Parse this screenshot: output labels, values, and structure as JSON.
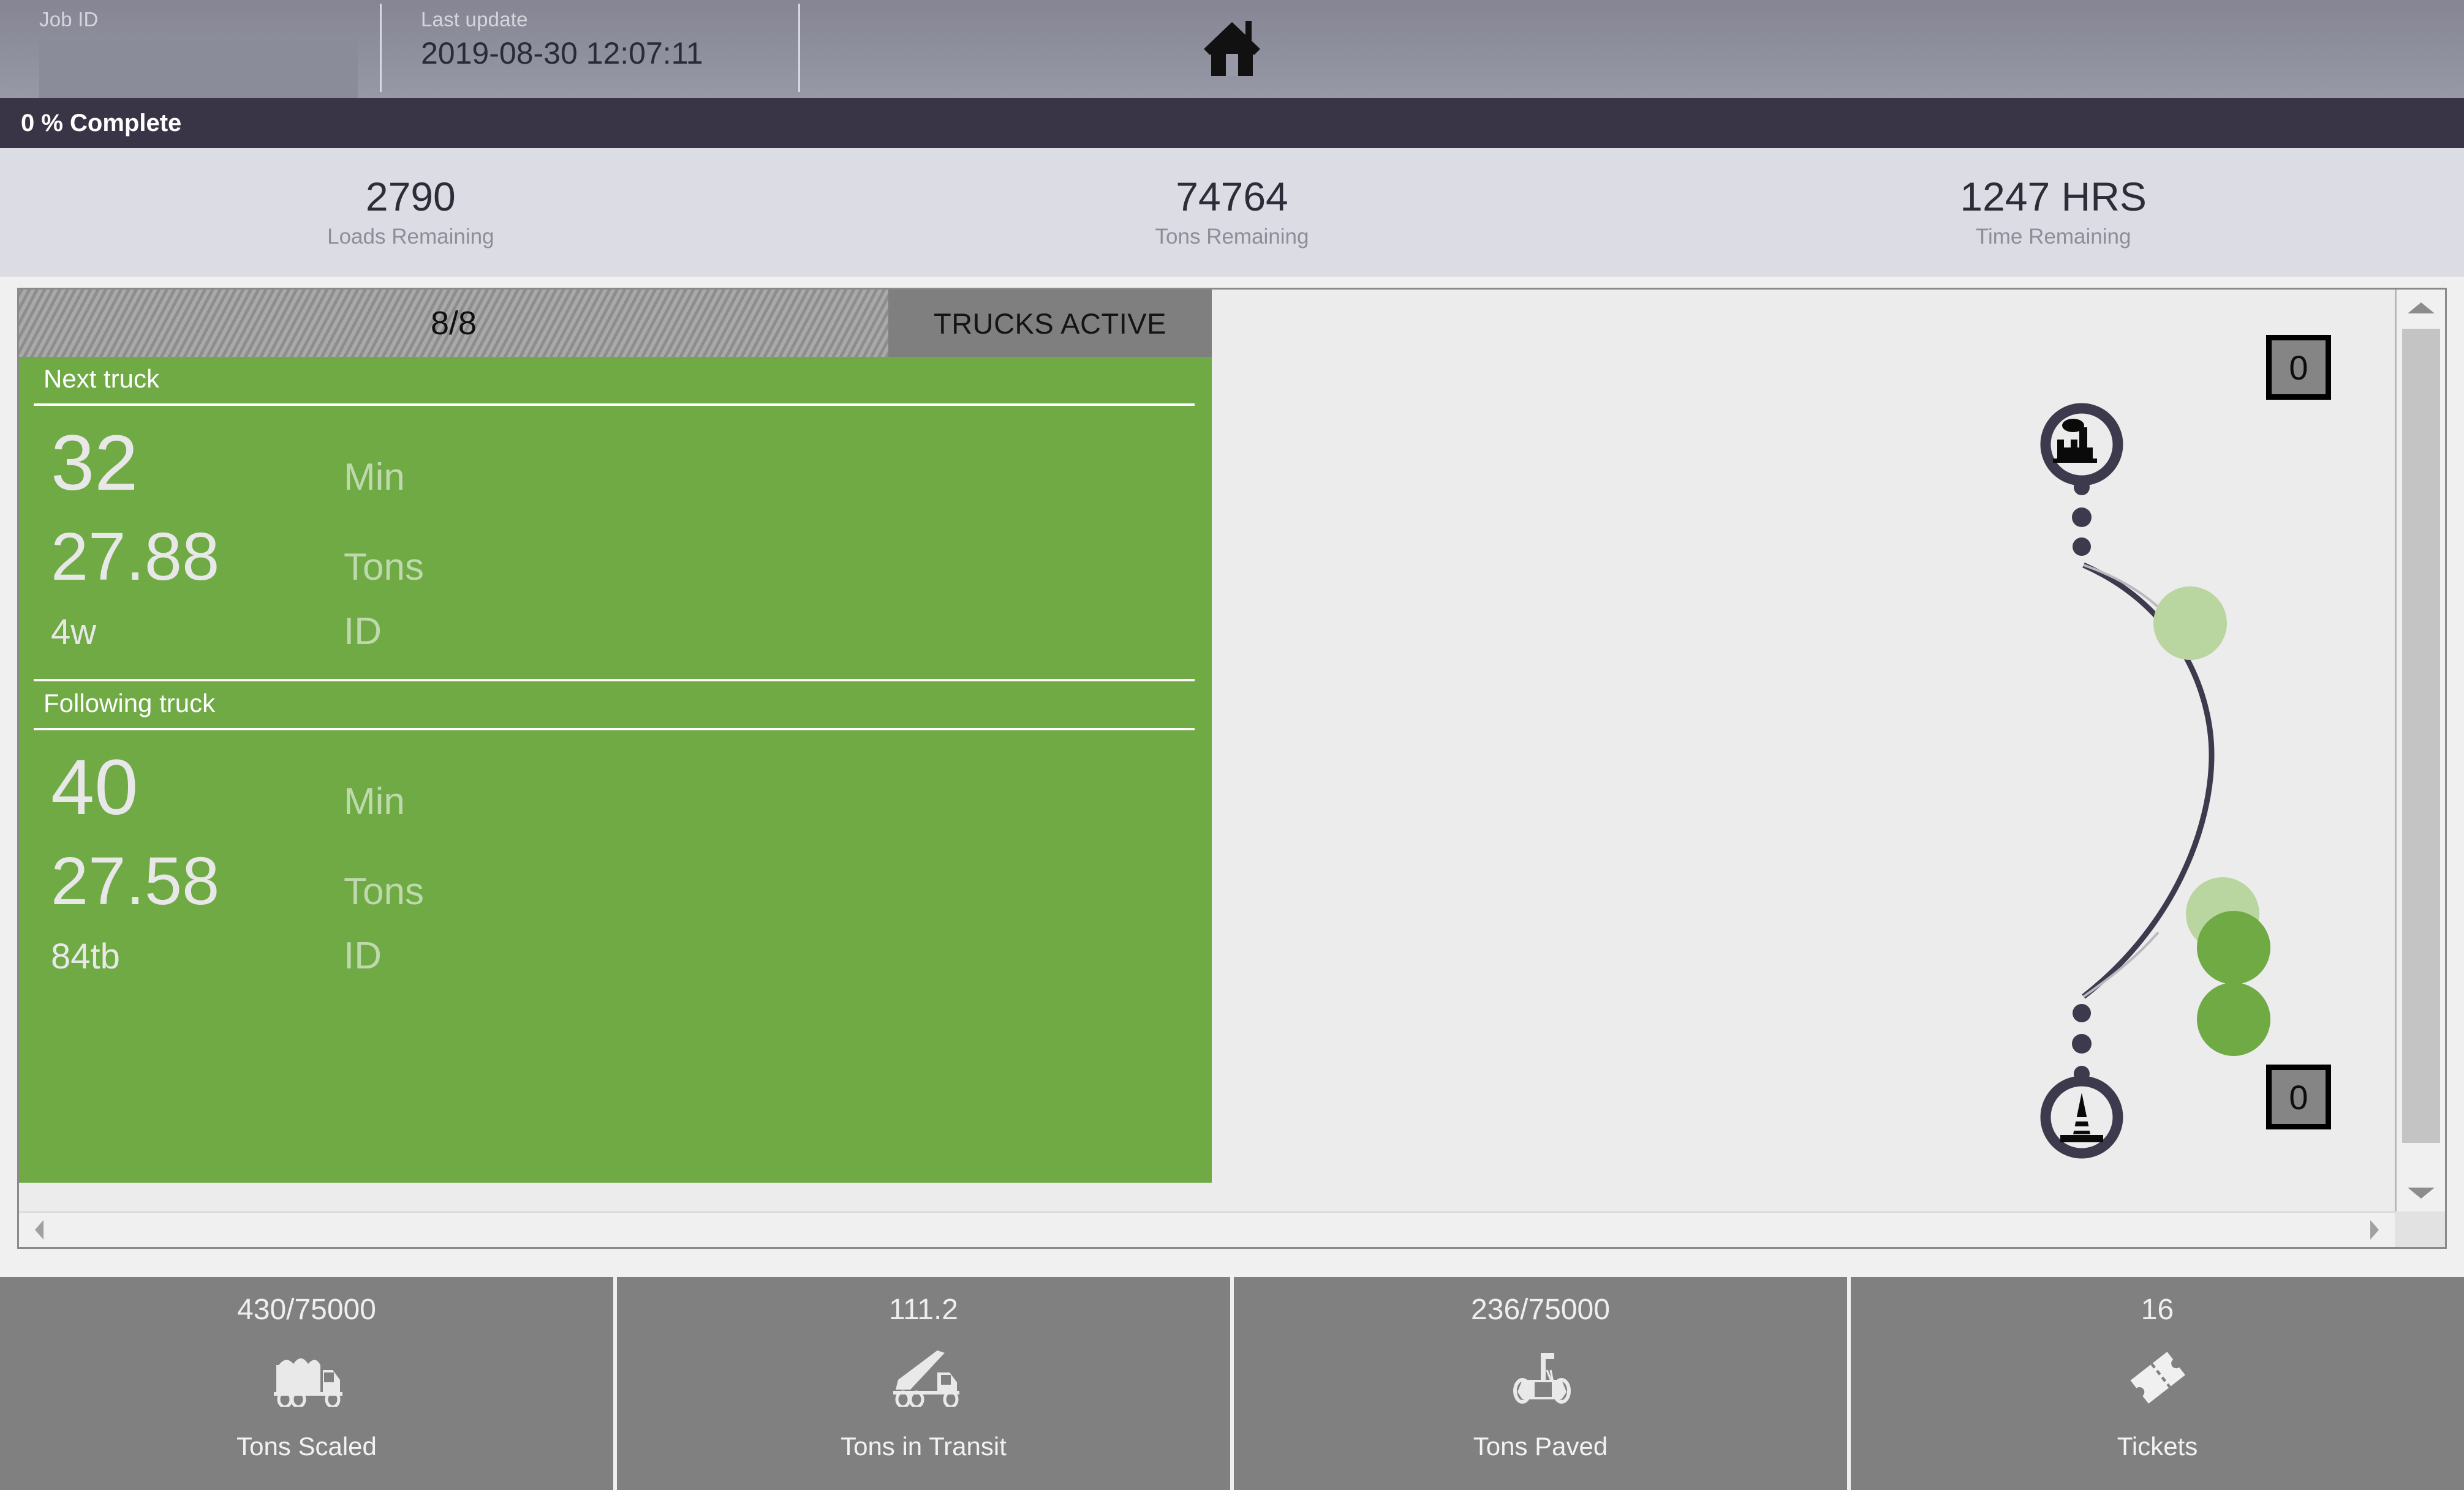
{
  "header": {
    "job_id_label": "Job ID",
    "job_id_value": "",
    "job_id_placeholder": "",
    "last_update_label": "Last update",
    "last_update_value": "2019-08-30 12:07:11",
    "home_icon": "home-icon"
  },
  "progress": {
    "text": "0 % Complete",
    "percent": 0,
    "bar_color": "#6ea644",
    "track_color": "#393546"
  },
  "kpis": [
    {
      "value": "2790",
      "label": "Loads Remaining"
    },
    {
      "value": "74764",
      "label": "Tons Remaining"
    },
    {
      "value": "1247 HRS",
      "label": "Time Remaining"
    }
  ],
  "trucks_active": {
    "count": "8/8",
    "label": "TRUCKS ACTIVE",
    "active": 8,
    "total": 8
  },
  "truck_panel": {
    "accent_color": "#6faa45",
    "next": {
      "title": "Next truck",
      "minutes": "32",
      "minutes_unit": "Min",
      "tons": "27.88",
      "tons_unit": "Tons",
      "id": "4w",
      "id_unit": "ID"
    },
    "following": {
      "title": "Following truck",
      "minutes": "40",
      "minutes_unit": "Min",
      "tons": "27.58",
      "tons_unit": "Tons",
      "id": "84tb",
      "id_unit": "ID"
    }
  },
  "route": {
    "plant_icon": "factory-icon",
    "site_icon": "traffic-cone-icon",
    "badge_top": "0",
    "badge_bottom": "0",
    "truck_dots": [
      {
        "state": "faded",
        "color": "#b9d5a0"
      },
      {
        "state": "faded",
        "color": "#b9d5a0"
      },
      {
        "state": "solid",
        "color": "#6faa45"
      },
      {
        "state": "solid",
        "color": "#6faa45"
      }
    ]
  },
  "bottom_stats": [
    {
      "value": "430/75000",
      "label": "Tons Scaled",
      "icon": "dump-truck-loaded-icon"
    },
    {
      "value": "111.2",
      "label": "Tons in Transit",
      "icon": "dump-truck-tipping-icon"
    },
    {
      "value": "236/75000",
      "label": "Tons Paved",
      "icon": "paver-icon"
    },
    {
      "value": "16",
      "label": "Tickets",
      "icon": "ticket-icon"
    }
  ],
  "scrollbars": {
    "vertical_up": "scroll-up-arrow",
    "vertical_down": "scroll-down-arrow",
    "horizontal_left": "scroll-left-arrow",
    "horizontal_right": "scroll-right-arrow"
  }
}
